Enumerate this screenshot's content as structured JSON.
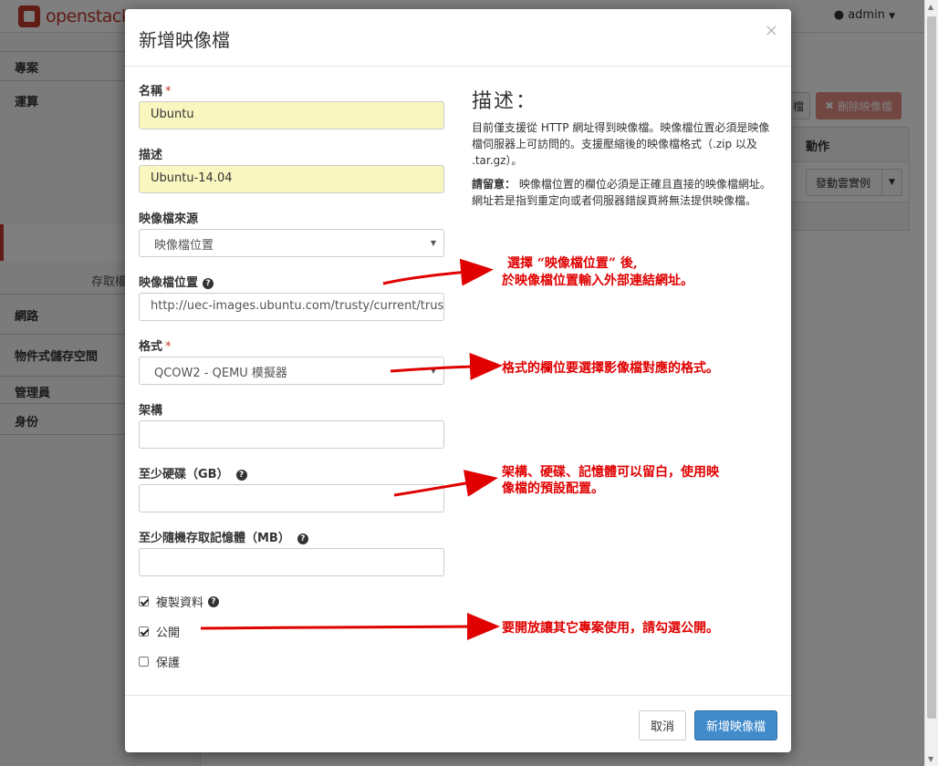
{
  "brand": {
    "name": "openstack"
  },
  "user_menu": {
    "label": "admin"
  },
  "sidebar": {
    "items": [
      {
        "label": "專案"
      },
      {
        "label": "運算"
      },
      {
        "label": "網路"
      },
      {
        "label": "物件式儲存空間"
      },
      {
        "label": "管理員"
      },
      {
        "label": "身份"
      }
    ],
    "sub_partial": "存取權"
  },
  "background": {
    "button_partial": "檔",
    "delete_button": "刪除映像檔",
    "table_header": "動作",
    "row_action": "發動雲實例"
  },
  "modal": {
    "title": "新增映像檔",
    "close": "×",
    "fields": {
      "name": {
        "label": "名稱",
        "required": "*",
        "value": "Ubuntu"
      },
      "description": {
        "label": "描述",
        "value": "Ubuntu-14.04"
      },
      "source": {
        "label": "映像檔來源",
        "value": "映像檔位置"
      },
      "location": {
        "label": "映像檔位置",
        "value": "http://uec-images.ubuntu.com/trusty/current/trusty-se"
      },
      "format": {
        "label": "格式",
        "required": "*",
        "value": "QCOW2 - QEMU 模擬器"
      },
      "architecture": {
        "label": "架構",
        "value": ""
      },
      "min_disk": {
        "label": "至少硬碟（GB）",
        "value": ""
      },
      "min_ram": {
        "label": "至少隨機存取記憶體（MB）",
        "value": ""
      }
    },
    "checkboxes": {
      "copy_data": {
        "label": "複製資料",
        "checked": true
      },
      "public": {
        "label": "公開",
        "checked": true
      },
      "protected": {
        "label": "保護",
        "checked": false
      }
    },
    "description_panel": {
      "title": "描述：",
      "p1": "目前僅支援從 HTTP 網址得到映像檔。映像檔位置必須是映像檔伺服器上可訪問的。支援壓縮後的映像檔格式（.zip 以及 .tar.gz）。",
      "p2_bold": "請留意：",
      "p2": "映像檔位置的欄位必須是正確且直接的映像檔網址。網址若是指到重定向或者伺服器錯誤頁將無法提供映像檔。"
    },
    "footer": {
      "cancel": "取消",
      "submit": "新增映像檔"
    }
  },
  "annotations": {
    "location_note_1": "選擇 “映像檔位置” 後,",
    "location_note_2": "於映像檔位置輸入外部連結網址。",
    "format_note": "格式的欄位要選擇影像檔對應的格式。",
    "optional_note_1": "架構、硬碟、記憶體可以留白，使用映",
    "optional_note_2": "像檔的預設配置。",
    "public_note": "要開放讓其它專案使用，請勾選公開。"
  },
  "colors": {
    "annotation": "#e00000",
    "primary": "#428bca",
    "danger": "#d9534f",
    "brand": "#c0392b"
  }
}
